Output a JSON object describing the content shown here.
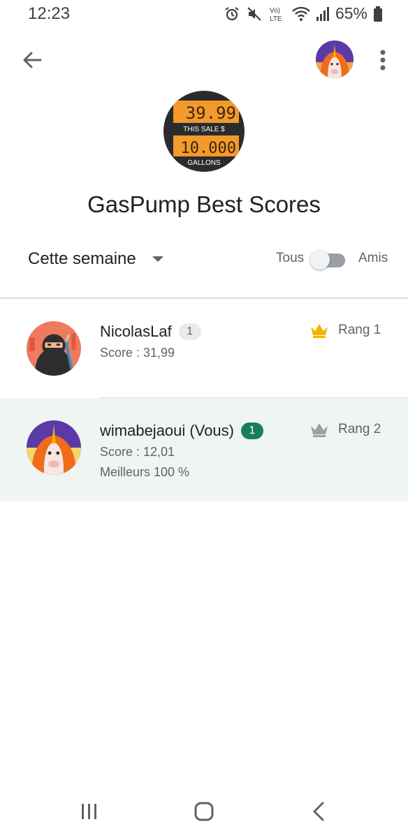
{
  "status_bar": {
    "time": "12:23",
    "battery_percent": "65%",
    "network_label": "Vo) LTE",
    "icons": [
      "alarm-icon",
      "mute-icon",
      "volte-icon",
      "wifi-icon",
      "signal-icon",
      "battery-icon"
    ]
  },
  "app_bar": {
    "back_icon": "arrow-back-icon",
    "more_icon": "more-vert-icon",
    "profile_avatar": "unicorn-avatar"
  },
  "game": {
    "icon_sale_value": "39.99",
    "icon_sale_label": "THIS SALE $",
    "icon_gallons_value": "10.000",
    "icon_gallons_label": "GALLONS",
    "title": "GasPump Best Scores"
  },
  "filters": {
    "period": "Cette semaine",
    "toggle_left_label": "Tous",
    "toggle_right_label": "Amis",
    "toggle_on": false
  },
  "leaderboard": [
    {
      "name": "NicolasLaf",
      "level": "1",
      "score": "Score : 31,99",
      "percentile": "",
      "rank": "Rang 1",
      "crown_color": "#f4b400",
      "avatar": "ninja-avatar",
      "is_self": false
    },
    {
      "name": "wimabejaoui (Vous)",
      "level": "1",
      "score": "Score : 12,01",
      "percentile": "Meilleurs 100 %",
      "rank": "Rang 2",
      "crown_color": "#9aa0a6",
      "avatar": "unicorn-avatar",
      "is_self": true
    }
  ],
  "colors": {
    "self_row_background": "#eef5f3",
    "self_badge": "#1b7e5a",
    "gold_crown": "#f4b400",
    "silver_crown": "#9aa0a6"
  },
  "nav_bar": {
    "icons": [
      "recents-icon",
      "home-icon",
      "back-icon"
    ]
  }
}
